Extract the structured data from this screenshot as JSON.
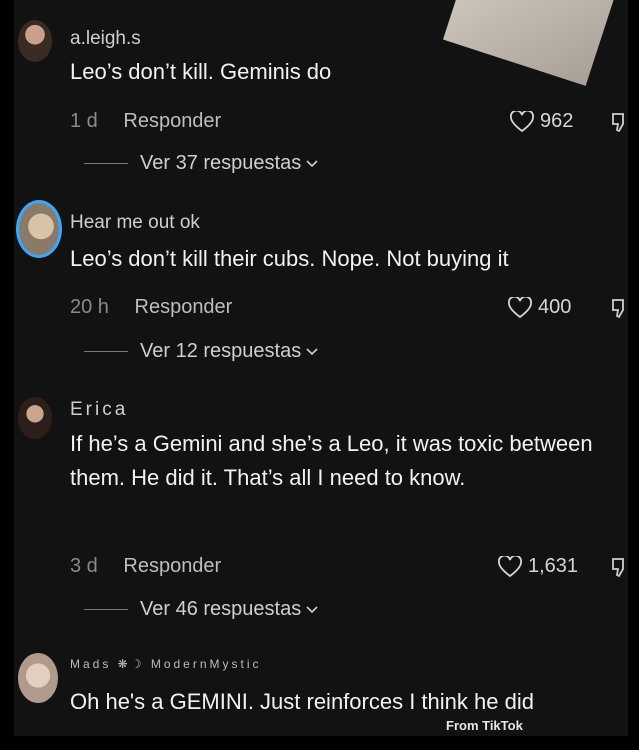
{
  "comments": [
    {
      "author": "a.leigh.s",
      "text": "Leo’s don’t kill. Geminis do",
      "time": "1 d",
      "reply_label": "Responder",
      "likes": "962",
      "replies_label": "Ver 37 respuestas"
    },
    {
      "author": "Hear me out ok",
      "text": "Leo’s don’t kill their cubs. Nope. Not buying it",
      "time": "20 h",
      "reply_label": "Responder",
      "likes": "400",
      "replies_label": "Ver 12 respuestas"
    },
    {
      "author": "Erica",
      "text": "If he’s a Gemini and she’s a Leo, it was toxic between them. He did it. That’s all I need to know.",
      "time": "3 d",
      "reply_label": "Responder",
      "likes": "1,631",
      "replies_label": "Ver 46 respuestas"
    },
    {
      "author": "Mads ❋☽ ModernMystic",
      "text": "Oh he's a GEMINI. Just reinforces I think he did"
    }
  ],
  "watermark": "From TikTok",
  "icons": {
    "like": "heart-icon",
    "dislike": "thumb-down-icon",
    "expand": "chevron-down-icon"
  },
  "colors": {
    "background": "#121212",
    "avatar_ring": "#3aa7ff"
  }
}
